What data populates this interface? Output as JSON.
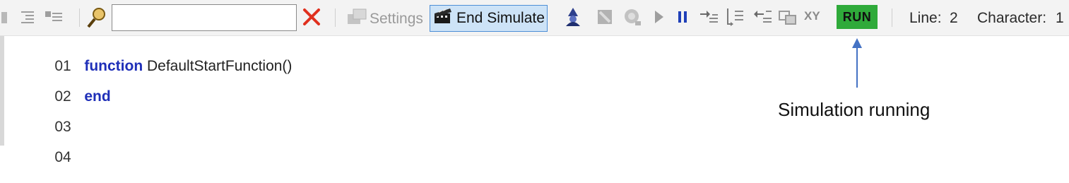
{
  "toolbar": {
    "search": {
      "value": "",
      "placeholder": ""
    },
    "settings_label": "Settings",
    "end_simulate_label": "End Simulate",
    "xy_label": "XY",
    "run_label": "RUN",
    "line_label": "Line:",
    "line_value": "2",
    "character_label": "Character:",
    "character_value": "1"
  },
  "colors": {
    "run_badge": "#2faa3a",
    "keyword": "#1f2fb8",
    "end_simulate_bg": "#cde3f7",
    "clear_x": "#e0301e",
    "pause": "#1f3fb8",
    "arrow": "#4472c4"
  },
  "icons": [
    "indent-icon",
    "outdent-icon",
    "comment-icon",
    "search-icon",
    "clear-search-icon",
    "settings-icon",
    "end-simulate-icon",
    "wizard-icon",
    "stop-icon",
    "record-icon",
    "play-icon",
    "pause-icon",
    "step-into-icon",
    "step-over-icon",
    "step-out-icon",
    "watch-icon"
  ],
  "editor": {
    "lines": [
      {
        "num": "01",
        "keyword": "function",
        "text": "DefaultStartFunction()"
      },
      {
        "num": "02",
        "keyword": "end",
        "text": ""
      },
      {
        "num": "03",
        "keyword": "",
        "text": ""
      },
      {
        "num": "04",
        "keyword": "",
        "text": ""
      }
    ]
  },
  "annotation": {
    "text": "Simulation running"
  }
}
